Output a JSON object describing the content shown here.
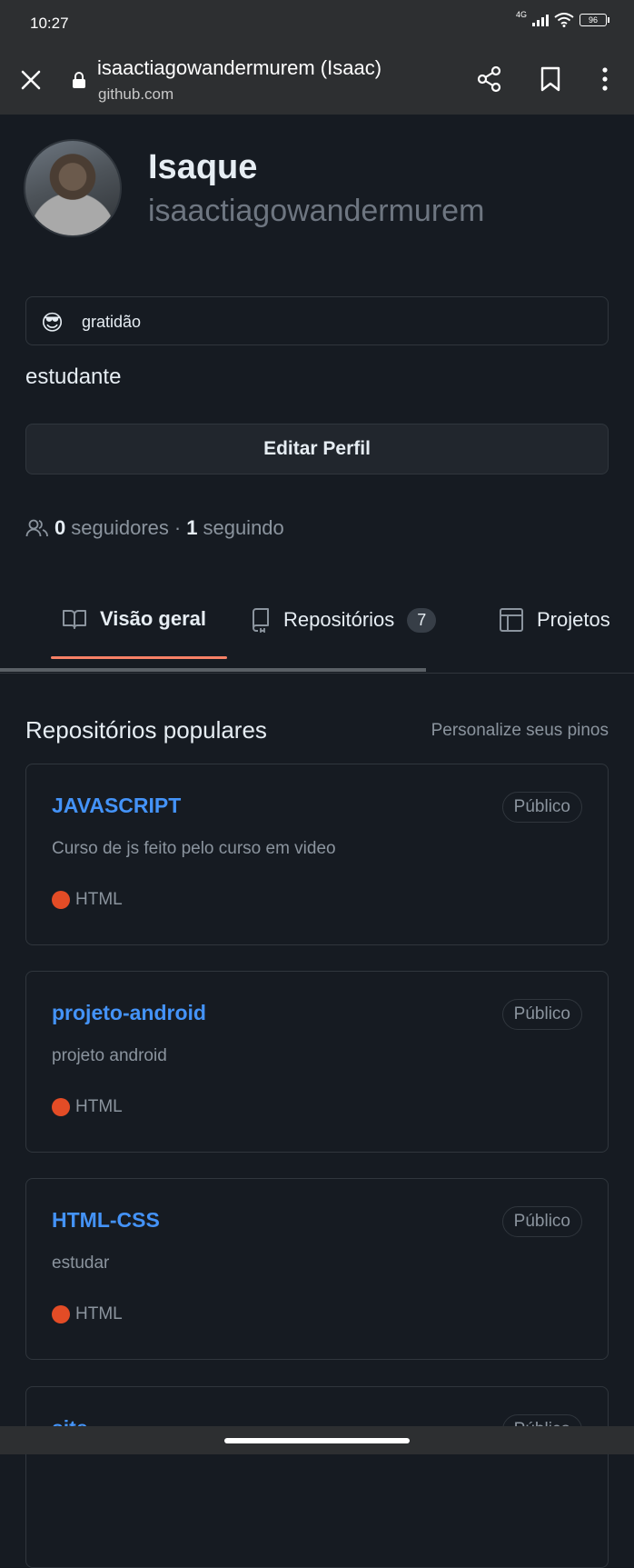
{
  "statusbar": {
    "time": "10:27",
    "network": "4G",
    "battery": "96"
  },
  "browser": {
    "title": "isaactiagowandermurem (Isaac)",
    "domain": "github.com"
  },
  "profile": {
    "name": "Isaque",
    "login": "isaactiagowandermurem",
    "status_emoji": "😎",
    "status_text": "gratidão",
    "bio": "estudante",
    "edit_label": "Editar Perfil",
    "followers_count": "0",
    "followers_label": "seguidores",
    "separator": "·",
    "following_count": "1",
    "following_label": "seguindo"
  },
  "tabs": [
    {
      "label": "Visão geral",
      "icon": "book-icon",
      "active": true
    },
    {
      "label": "Repositórios",
      "icon": "repo-icon",
      "count": "7"
    },
    {
      "label": "Projetos",
      "icon": "table-icon"
    }
  ],
  "popular": {
    "title": "Repositórios populares",
    "customize": "Personalize seus pinos",
    "repos": [
      {
        "name": "JAVASCRIPT",
        "visibility": "Público",
        "description": "Curso de js feito pelo curso em video",
        "language": "HTML",
        "language_color": "#e34c26"
      },
      {
        "name": "projeto-android",
        "visibility": "Público",
        "description": "projeto android",
        "language": "HTML",
        "language_color": "#e34c26"
      },
      {
        "name": "HTML-CSS",
        "visibility": "Público",
        "description": "estudar",
        "language": "HTML",
        "language_color": "#e34c26"
      },
      {
        "name": "site",
        "visibility": "Público"
      }
    ]
  },
  "colors": {
    "accent": "#f78166",
    "link": "#4493f8",
    "background": "#161b22"
  }
}
